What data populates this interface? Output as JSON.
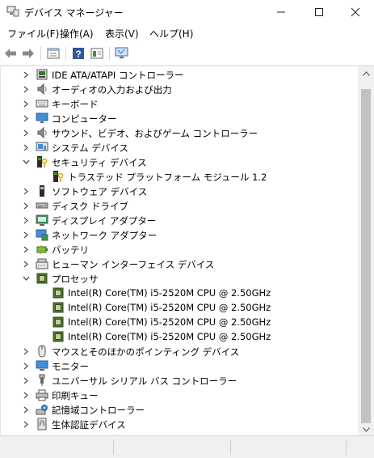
{
  "window": {
    "title": "デバイス マネージャー"
  },
  "menu": [
    "ファイル(F)",
    "操作(A)",
    "表示(V)",
    "ヘルプ(H)"
  ],
  "toolbar": [
    {
      "name": "back-arrow-icon"
    },
    {
      "name": "forward-arrow-icon"
    },
    {
      "name": "properties-icon"
    },
    {
      "name": "help-icon"
    },
    {
      "name": "view-icon"
    },
    {
      "name": "monitor-scan-icon"
    }
  ],
  "tree": {
    "items": [
      {
        "label": "IDE ATA/ATAPI コントローラー",
        "level": 1,
        "state": "collapsed",
        "icon": "ide-controller-icon"
      },
      {
        "label": "オーディオの入力および出力",
        "level": 1,
        "state": "collapsed",
        "icon": "speaker-icon"
      },
      {
        "label": "キーボード",
        "level": 1,
        "state": "collapsed",
        "icon": "keyboard-icon"
      },
      {
        "label": "コンピューター",
        "level": 1,
        "state": "collapsed",
        "icon": "computer-icon"
      },
      {
        "label": "サウンド、ビデオ、およびゲーム コントローラー",
        "level": 1,
        "state": "collapsed",
        "icon": "speaker-icon"
      },
      {
        "label": "システム デバイス",
        "level": 1,
        "state": "collapsed",
        "icon": "system-device-icon"
      },
      {
        "label": "セキュリティ デバイス",
        "level": 1,
        "state": "expanded",
        "icon": "security-device-icon"
      },
      {
        "label": "トラステッド プラットフォーム モジュール 1.2",
        "level": 2,
        "state": "none",
        "icon": "security-device-icon"
      },
      {
        "label": "ソフトウェア デバイス",
        "level": 1,
        "state": "collapsed",
        "icon": "software-device-icon"
      },
      {
        "label": "ディスク ドライブ",
        "level": 1,
        "state": "collapsed",
        "icon": "disk-drive-icon"
      },
      {
        "label": "ディスプレイ アダプター",
        "level": 1,
        "state": "collapsed",
        "icon": "display-adapter-icon"
      },
      {
        "label": "ネットワーク アダプター",
        "level": 1,
        "state": "collapsed",
        "icon": "network-adapter-icon"
      },
      {
        "label": "バッテリ",
        "level": 1,
        "state": "collapsed",
        "icon": "battery-icon"
      },
      {
        "label": "ヒューマン インターフェイス デバイス",
        "level": 1,
        "state": "collapsed",
        "icon": "hid-icon"
      },
      {
        "label": "プロセッサ",
        "level": 1,
        "state": "expanded",
        "icon": "processor-icon"
      },
      {
        "label": "Intel(R) Core(TM) i5-2520M CPU @ 2.50GHz",
        "level": 2,
        "state": "none",
        "icon": "processor-icon"
      },
      {
        "label": "Intel(R) Core(TM) i5-2520M CPU @ 2.50GHz",
        "level": 2,
        "state": "none",
        "icon": "processor-icon"
      },
      {
        "label": "Intel(R) Core(TM) i5-2520M CPU @ 2.50GHz",
        "level": 2,
        "state": "none",
        "icon": "processor-icon"
      },
      {
        "label": "Intel(R) Core(TM) i5-2520M CPU @ 2.50GHz",
        "level": 2,
        "state": "none",
        "icon": "processor-icon"
      },
      {
        "label": "マウスとそのほかのポインティング デバイス",
        "level": 1,
        "state": "collapsed",
        "icon": "mouse-icon"
      },
      {
        "label": "モニター",
        "level": 1,
        "state": "collapsed",
        "icon": "monitor-icon"
      },
      {
        "label": "ユニバーサル シリアル バス コントローラー",
        "level": 1,
        "state": "collapsed",
        "icon": "usb-icon"
      },
      {
        "label": "印刷キュー",
        "level": 1,
        "state": "collapsed",
        "icon": "printer-icon"
      },
      {
        "label": "記憶域コントローラー",
        "level": 1,
        "state": "collapsed",
        "icon": "storage-controller-icon"
      },
      {
        "label": "生体認証デバイス",
        "level": 1,
        "state": "collapsed",
        "icon": "biometric-icon"
      }
    ]
  },
  "colors": {
    "accent": "#0063b1",
    "processor": "#4e7a2c",
    "scroll_thumb": "#c2c2c2",
    "statusbar": "#f0f0f0"
  }
}
